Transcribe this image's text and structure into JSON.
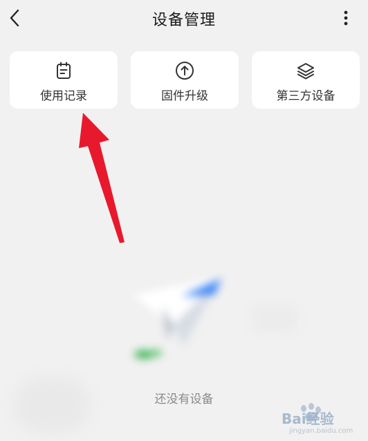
{
  "header": {
    "title": "设备管理"
  },
  "cards": [
    {
      "label": "使用记录",
      "icon": "clipboard-icon"
    },
    {
      "label": "固件升级",
      "icon": "upload-circle-icon"
    },
    {
      "label": "第三方设备",
      "icon": "layers-icon"
    }
  ],
  "empty_state": {
    "text": "还没有设备",
    "illustration": "paper-plane-illustration"
  },
  "annotation": {
    "arrow_color": "#e8192c"
  },
  "watermark": {
    "text": "Bai经验",
    "sub": "jingyan.baidu.com"
  },
  "colors": {
    "background": "#f1f1f1",
    "card": "#ffffff",
    "accent_blue": "#3f86f4",
    "accent_green": "#36b24a"
  }
}
